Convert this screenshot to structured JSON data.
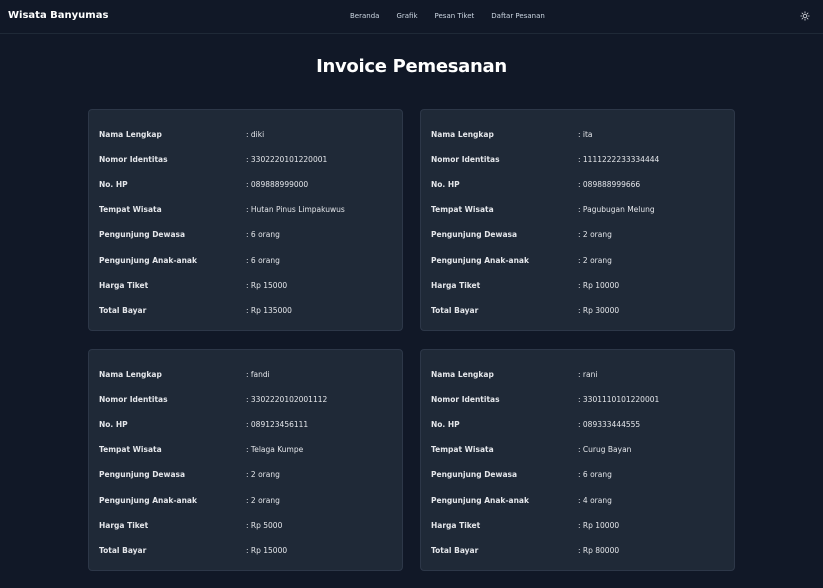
{
  "navbar": {
    "brand": "Wisata Banyumas",
    "links": [
      "Beranda",
      "Grafik",
      "Pesan Tiket",
      "Daftar Pesanan"
    ],
    "theme_icon": "sun-icon"
  },
  "page": {
    "title": "Invoice Pemesanan"
  },
  "labels": {
    "name": "Nama Lengkap",
    "id_number": "Nomor Identitas",
    "phone": "No. HP",
    "destination": "Tempat Wisata",
    "adults": "Pengunjung Dewasa",
    "children": "Pengunjung Anak-anak",
    "ticket_price": "Harga Tiket",
    "total": "Total Bayar"
  },
  "invoices": [
    {
      "name": ": diki",
      "id_number": ": 3302220101220001",
      "phone": ": 089888999000",
      "destination": ": Hutan Pinus Limpakuwus",
      "adults": ": 6 orang",
      "children": ": 6 orang",
      "ticket_price": ": Rp 15000",
      "total": ": Rp 135000"
    },
    {
      "name": ": ita",
      "id_number": ": 1111222233334444",
      "phone": ": 089888999666",
      "destination": ": Pagubugan Melung",
      "adults": ": 2 orang",
      "children": ": 2 orang",
      "ticket_price": ": Rp 10000",
      "total": ": Rp 30000"
    },
    {
      "name": ": fandi",
      "id_number": ": 3302220102001112",
      "phone": ": 089123456111",
      "destination": ": Telaga Kumpe",
      "adults": ": 2 orang",
      "children": ": 2 orang",
      "ticket_price": ": Rp 5000",
      "total": ": Rp 15000"
    },
    {
      "name": ": rani",
      "id_number": ": 3301110101220001",
      "phone": ": 089333444555",
      "destination": ": Curug Bayan",
      "adults": ": 6 orang",
      "children": ": 4 orang",
      "ticket_price": ": Rp 10000",
      "total": ": Rp 80000"
    }
  ]
}
